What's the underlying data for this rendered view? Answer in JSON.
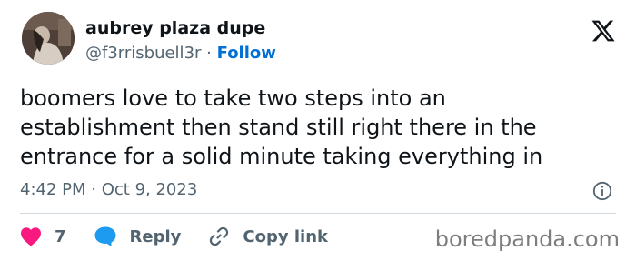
{
  "author": {
    "display_name": "aubrey plaza dupe",
    "handle": "@f3rrisbuell3r",
    "separator": "·",
    "follow_label": "Follow"
  },
  "tweet": {
    "lines": [
      "boomers love to take two steps into an",
      "establishment then stand still right there in the",
      "entrance for a solid minute taking everything in"
    ]
  },
  "meta": {
    "time": "4:42 PM",
    "separator": "·",
    "date": "Oct 9, 2023"
  },
  "actions": {
    "likes_count": "7",
    "reply_label": "Reply",
    "copy_link_label": "Copy link"
  },
  "watermark": "boredpanda.com",
  "icons": {
    "logo": "x-logo-icon",
    "info": "info-icon",
    "like": "heart-icon",
    "reply": "speech-bubble-icon",
    "copy": "link-icon"
  },
  "colors": {
    "text": "#0f1419",
    "secondary": "#536471",
    "follow": "#006fd6",
    "heart": "#f91880",
    "reply": "#1d9bf0",
    "divider": "#cfd9de"
  }
}
